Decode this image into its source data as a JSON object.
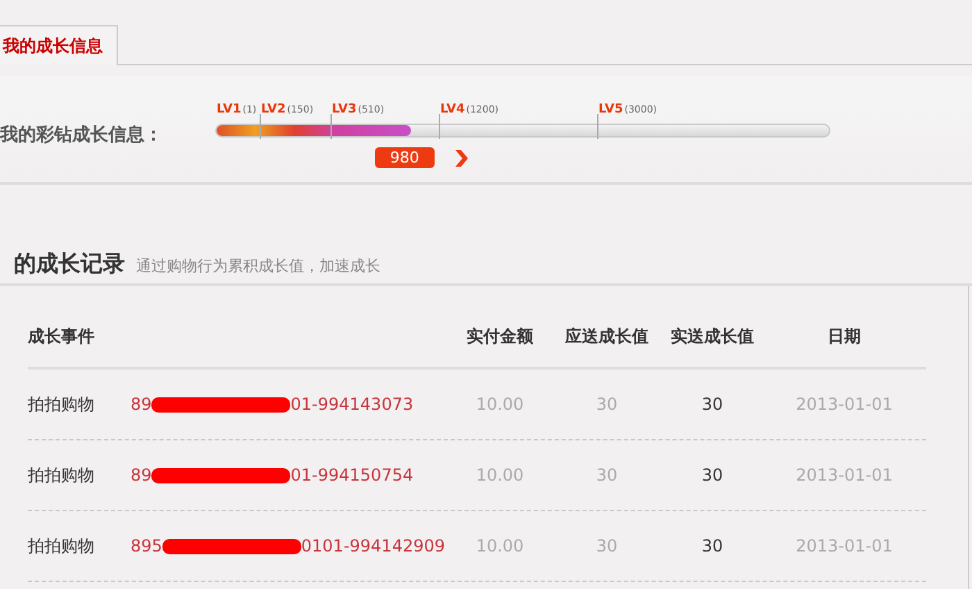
{
  "tabs": [
    {
      "label": "我的成长信息",
      "selected": true
    }
  ],
  "growth": {
    "label": "我的彩钻成长信息：",
    "level": 0.318,
    "levels": [
      {
        "name": "LV1",
        "threshold": "(1)"
      },
      {
        "name": "LV2",
        "threshold": "(150)"
      },
      {
        "name": "LV3",
        "threshold": "(510)"
      },
      {
        "name": "LV4",
        "threshold": "(1200)"
      },
      {
        "name": "LV5",
        "threshold": "(3000)"
      }
    ],
    "value": "980"
  },
  "records": {
    "title": "的成长记录",
    "subtitle": "通过购物行为累积成长值，加速成长",
    "columns": [
      "成长事件",
      "实付金额",
      "应送成长值",
      "实送成长值",
      "日期"
    ],
    "rows": [
      {
        "event": "拍拍购物",
        "order_prefix": "89",
        "order_suffix": "01-994143073",
        "amount": "10.00",
        "expected": "30",
        "actual": "30",
        "date": "2013-01-01"
      },
      {
        "event": "拍拍购物",
        "order_prefix": "89",
        "order_suffix": "01-994150754",
        "amount": "10.00",
        "expected": "30",
        "actual": "30",
        "date": "2013-01-01"
      },
      {
        "event": "拍拍购物",
        "order_prefix": "895",
        "order_suffix": "0101-994142909",
        "amount": "10.00",
        "expected": "30",
        "actual": "30",
        "date": "2013-01-01"
      }
    ]
  }
}
